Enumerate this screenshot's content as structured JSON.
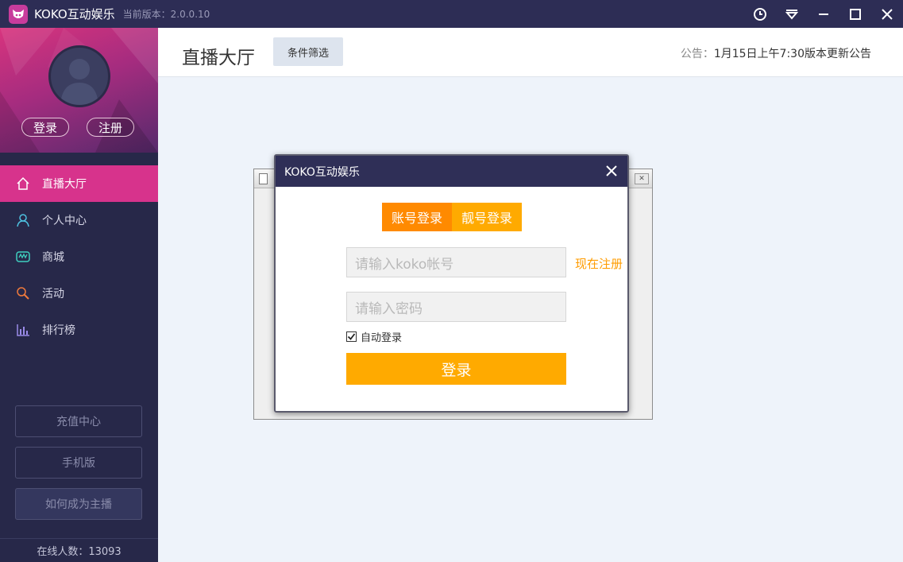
{
  "window": {
    "app_title": "KOKO互动娱乐",
    "version": "当前版本：2.0.0.10",
    "icons": [
      "history-icon",
      "dropdown-menu-icon",
      "minimize-icon",
      "maximize-icon",
      "close-icon"
    ]
  },
  "sidebar": {
    "login_label": "登录",
    "register_label": "注册",
    "items": [
      {
        "label": "直播大厅",
        "icon": "home-icon",
        "active": true
      },
      {
        "label": "个人中心",
        "icon": "person-icon",
        "active": false
      },
      {
        "label": "商城",
        "icon": "shop-icon",
        "active": false
      },
      {
        "label": "活动",
        "icon": "activity-icon",
        "active": false
      },
      {
        "label": "排行榜",
        "icon": "ranking-icon",
        "active": false
      }
    ],
    "recharge_label": "充值中心",
    "mobile_label": "手机版",
    "become_host_label": "如何成为主播",
    "online_count": "在线人数：13093"
  },
  "header": {
    "title": "直播大厅",
    "filter_label": "条件筛选",
    "notice_label": "公告：",
    "notice_text": "1月15日上午7:30版本更新公告"
  },
  "login_dialog": {
    "title": "KOKO互动娱乐",
    "tab_account": "账号登录",
    "tab_pretty": "靓号登录",
    "account_placeholder": "请输入koko帐号",
    "password_placeholder": "请输入密码",
    "register_now": "现在注册",
    "auto_login_label": "自动登录",
    "auto_login_checked": true,
    "submit_label": "登录"
  },
  "colors": {
    "titlebar": "#2d2d55",
    "sidebar": "#272849",
    "accent_pink": "#d7338c",
    "orange_dark": "#ff8a00",
    "orange": "#ffaa00"
  }
}
